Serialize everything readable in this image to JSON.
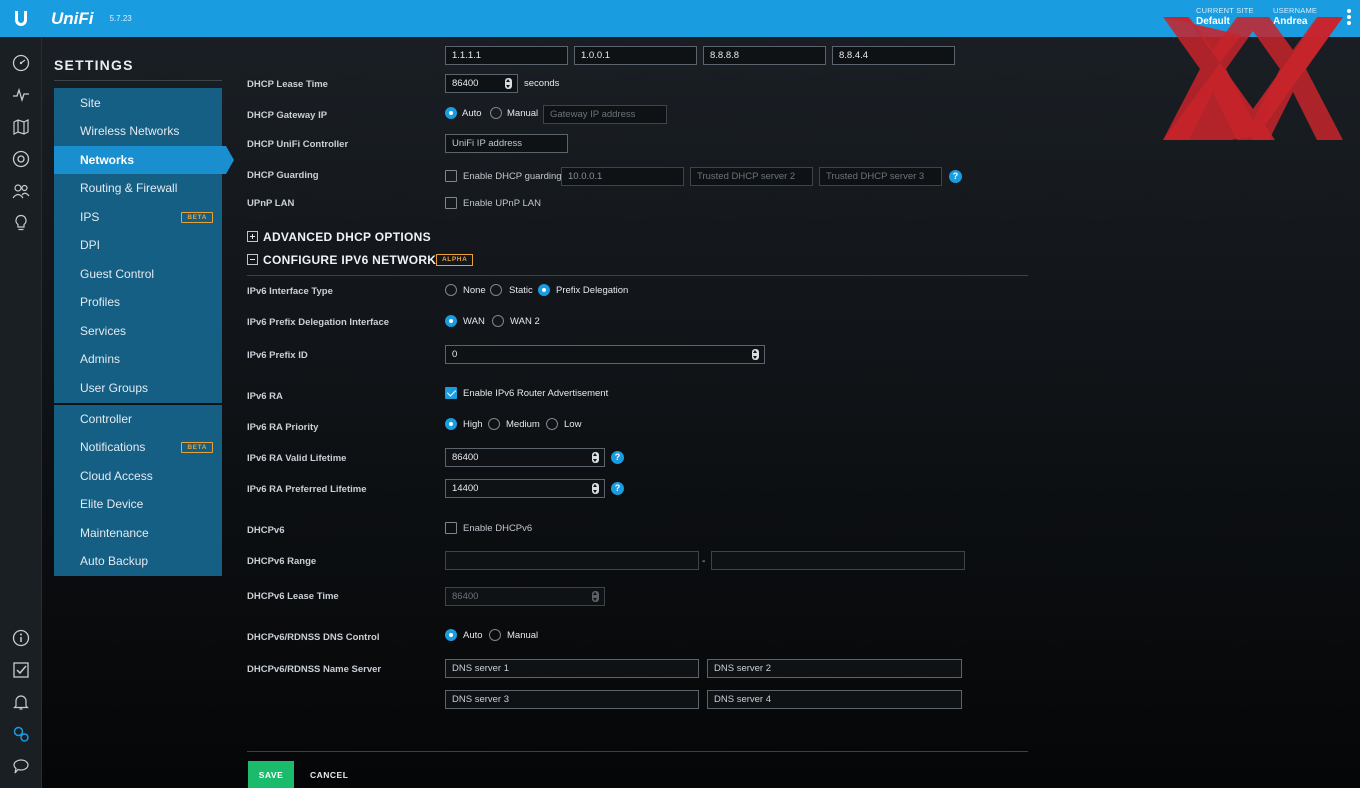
{
  "topbar": {
    "brand": "UniFi",
    "version": "5.7.23",
    "current_site_caption": "CURRENT SITE",
    "current_site": "Default",
    "username_caption": "USERNAME",
    "username": "Andrea"
  },
  "sidebar": {
    "title": "SETTINGS",
    "group1": [
      "Site",
      "Wireless Networks",
      "Networks",
      "Routing & Firewall",
      "IPS",
      "DPI",
      "Guest Control",
      "Profiles",
      "Services",
      "Admins",
      "User Groups"
    ],
    "group2": [
      "Controller",
      "Notifications",
      "Cloud Access",
      "Elite Device",
      "Maintenance",
      "Auto Backup"
    ],
    "active": "Networks",
    "beta_label": "BETA"
  },
  "dhcp": {
    "dns_servers": [
      "1.1.1.1",
      "1.0.0.1",
      "8.8.8.8",
      "8.8.4.4"
    ],
    "lease_time_label": "DHCP Lease Time",
    "lease_time": "86400",
    "lease_time_unit": "seconds",
    "gateway_label": "DHCP Gateway IP",
    "gateway_auto": "Auto",
    "gateway_manual": "Manual",
    "gateway_placeholder": "Gateway IP address",
    "controller_label": "DHCP UniFi Controller",
    "controller_placeholder": "UniFi IP address",
    "guarding_label": "DHCP Guarding",
    "guarding_check": "Enable DHCP guarding",
    "guarding_server1": "10.0.0.1",
    "guarding_server2_placeholder": "Trusted DHCP server 2",
    "guarding_server3_placeholder": "Trusted DHCP server 3",
    "upnp_label": "UPnP LAN",
    "upnp_check": "Enable UPnP LAN"
  },
  "sections": {
    "advanced_dhcp": "ADVANCED DHCP OPTIONS",
    "configure_ipv6": "CONFIGURE IPV6 NETWORK",
    "alpha_label": "ALPHA"
  },
  "ipv6": {
    "interface_type_label": "IPv6 Interface Type",
    "interface_type_options": [
      "None",
      "Static",
      "Prefix Delegation"
    ],
    "interface_type_selected": "Prefix Delegation",
    "pd_interface_label": "IPv6 Prefix Delegation Interface",
    "pd_interface_options": [
      "WAN",
      "WAN 2"
    ],
    "pd_interface_selected": "WAN",
    "prefix_id_label": "IPv6 Prefix ID",
    "prefix_id": "0",
    "ra_label": "IPv6 RA",
    "ra_check": "Enable IPv6 Router Advertisement",
    "ra_priority_label": "IPv6 RA Priority",
    "ra_priority_options": [
      "High",
      "Medium",
      "Low"
    ],
    "ra_priority_selected": "High",
    "ra_valid_label": "IPv6 RA Valid Lifetime",
    "ra_valid": "86400",
    "ra_preferred_label": "IPv6 RA Preferred Lifetime",
    "ra_preferred": "14400",
    "dhcpv6_label": "DHCPv6",
    "dhcpv6_check": "Enable DHCPv6",
    "dhcpv6_range_label": "DHCPv6 Range",
    "dhcpv6_range_separator": "-",
    "dhcpv6_lease_label": "DHCPv6 Lease Time",
    "dhcpv6_lease": "86400",
    "dns_control_label": "DHCPv6/RDNSS DNS Control",
    "dns_control_auto": "Auto",
    "dns_control_manual": "Manual",
    "name_server_label": "DHCPv6/RDNSS Name Server",
    "name_server_placeholders": [
      "DNS server 1",
      "DNS server 2",
      "DNS server 3",
      "DNS server 4"
    ]
  },
  "actions": {
    "save": "SAVE",
    "cancel": "CANCEL"
  },
  "colors": {
    "accent": "#1a9de0",
    "sidebar_bg": "#155e84",
    "save": "#1bbb6c",
    "badge": "#e8a23a"
  }
}
